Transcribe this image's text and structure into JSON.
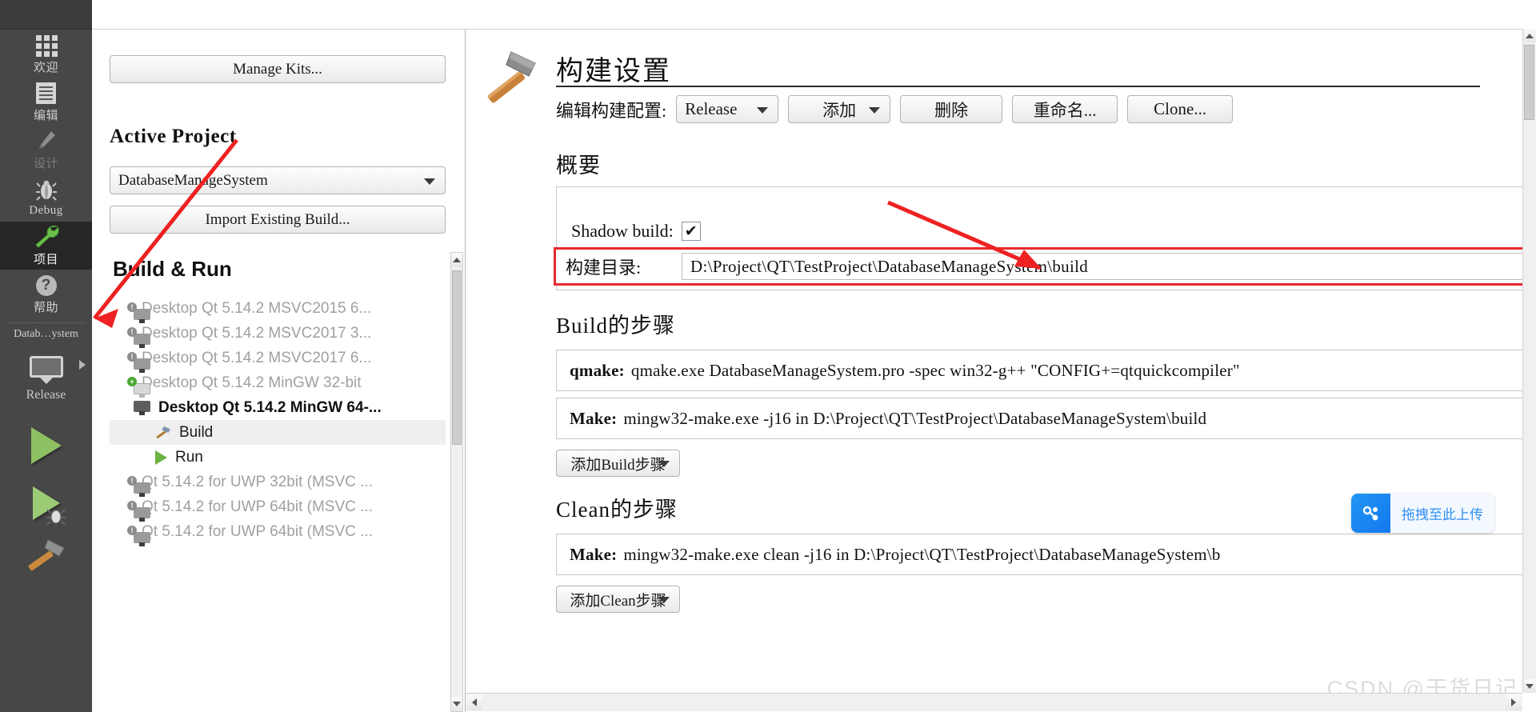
{
  "mode_bar": {
    "items": [
      {
        "label": "欢迎",
        "icon": "grid-icon",
        "state": "normal"
      },
      {
        "label": "编辑",
        "icon": "document-icon",
        "state": "normal"
      },
      {
        "label": "设计",
        "icon": "pencil-icon",
        "state": "disabled"
      },
      {
        "label": "Debug",
        "icon": "bug-icon",
        "state": "normal"
      },
      {
        "label": "项目",
        "icon": "wrench-icon",
        "state": "active"
      },
      {
        "label": "帮助",
        "icon": "question-icon",
        "state": "normal"
      }
    ],
    "project_kit": {
      "project_label": "Datab…ystem",
      "config_label": "Release",
      "icon": "monitor-icon"
    },
    "run_button": "run-icon",
    "debug_button": "run-debug-icon",
    "build_button": "hammer-icon"
  },
  "left_panel": {
    "manage_kits_label": "Manage Kits...",
    "active_project_title": "Active Project",
    "project_combo_value": "DatabaseManageSystem",
    "import_build_label": "Import Existing Build...",
    "tree_title": "Build & Run",
    "kits": [
      {
        "label": "Desktop Qt 5.14.2 MSVC2015 6...",
        "state": "disabled",
        "icon": "monitor-warning-icon"
      },
      {
        "label": "Desktop Qt 5.14.2 MSVC2017 3...",
        "state": "disabled",
        "icon": "monitor-warning-icon"
      },
      {
        "label": "Desktop Qt 5.14.2 MSVC2017 6...",
        "state": "disabled",
        "icon": "monitor-warning-icon"
      },
      {
        "label": "Desktop Qt 5.14.2 MinGW 32-bit",
        "state": "disabled",
        "icon": "monitor-add-icon"
      },
      {
        "label": "Desktop Qt 5.14.2 MinGW 64-...",
        "state": "active",
        "icon": "monitor-icon"
      }
    ],
    "kit_children": [
      {
        "label": "Build",
        "icon": "hammer-icon",
        "selected": true
      },
      {
        "label": "Run",
        "icon": "run-icon",
        "selected": false
      }
    ],
    "more_kits": [
      {
        "label": "Qt 5.14.2 for UWP 32bit (MSVC ...",
        "state": "disabled",
        "icon": "monitor-warning-icon"
      },
      {
        "label": "Qt 5.14.2 for UWP 64bit (MSVC ...",
        "state": "disabled",
        "icon": "monitor-warning-icon"
      },
      {
        "label": "Qt 5.14.2 for UWP 64bit (MSVC ...",
        "state": "disabled",
        "icon": "monitor-warning-icon"
      }
    ]
  },
  "build_settings": {
    "page_title": "构建设置",
    "page_icon": "hammer-icon",
    "config_label": "编辑构建配置:",
    "config_value": "Release",
    "buttons": [
      {
        "label": "添加",
        "dropdown": true
      },
      {
        "label": "删除",
        "dropdown": false
      },
      {
        "label": "重命名...",
        "dropdown": false
      },
      {
        "label": "Clone...",
        "dropdown": false
      }
    ],
    "summary_title": "概要",
    "shadow_build_label": "Shadow build:",
    "shadow_build_checked": "✔",
    "build_dir_label": "构建目录:",
    "build_dir_value": "D:\\Project\\QT\\TestProject\\DatabaseManageSystem\\build",
    "build_steps_title": "Build的步骤",
    "steps": [
      {
        "name": "qmake:",
        "command": "qmake.exe DatabaseManageSystem.pro -spec win32-g++ \"CONFIG+=qtquickcompiler\""
      },
      {
        "name": "Make:",
        "command": "mingw32-make.exe -j16 in D:\\Project\\QT\\TestProject\\DatabaseManageSystem\\build"
      }
    ],
    "add_build_step_label": "添加Build步骤",
    "clean_steps_title": "Clean的步骤",
    "clean_steps": [
      {
        "name": "Make:",
        "command": "mingw32-make.exe clean -j16 in D:\\Project\\QT\\TestProject\\DatabaseManageSystem\\b"
      }
    ],
    "add_clean_step_label": "添加Clean步骤"
  },
  "upload_widget": {
    "label": "拖拽至此上传",
    "icon": "cloud-share-icon",
    "accent": "#2196f3"
  },
  "watermark": "CSDN @干货日记",
  "annotation": {
    "accent": "#e8292c"
  }
}
